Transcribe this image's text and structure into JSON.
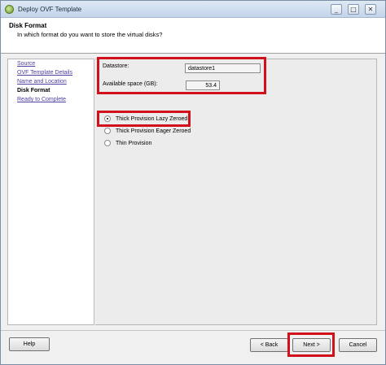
{
  "window": {
    "title": "Deploy OVF Template",
    "controls": [
      "_",
      "□",
      "✕"
    ]
  },
  "header": {
    "title": "Disk Format",
    "subtitle": "In which format do you want to store the virtual disks?"
  },
  "steps": [
    {
      "label": "Source",
      "state": "link"
    },
    {
      "label": "OVF Template Details",
      "state": "link"
    },
    {
      "label": "Name and Location",
      "state": "link"
    },
    {
      "label": "Disk Format",
      "state": "current"
    },
    {
      "label": "Ready to Complete",
      "state": "link"
    }
  ],
  "datastore": {
    "label": "Datastore:",
    "value": "datastore1"
  },
  "available_space": {
    "label": "Available space (GB):",
    "value": "53.4"
  },
  "disk_options": [
    {
      "label": "Thick Provision Lazy Zeroed",
      "selected": true
    },
    {
      "label": "Thick Provision Eager Zeroed",
      "selected": false
    },
    {
      "label": "Thin Provision",
      "selected": false
    }
  ],
  "buttons": {
    "help": "Help",
    "back": "< Back",
    "next": "Next >",
    "cancel": "Cancel"
  },
  "colors": {
    "highlight": "#d0101a",
    "link": "#4b3fa0"
  }
}
